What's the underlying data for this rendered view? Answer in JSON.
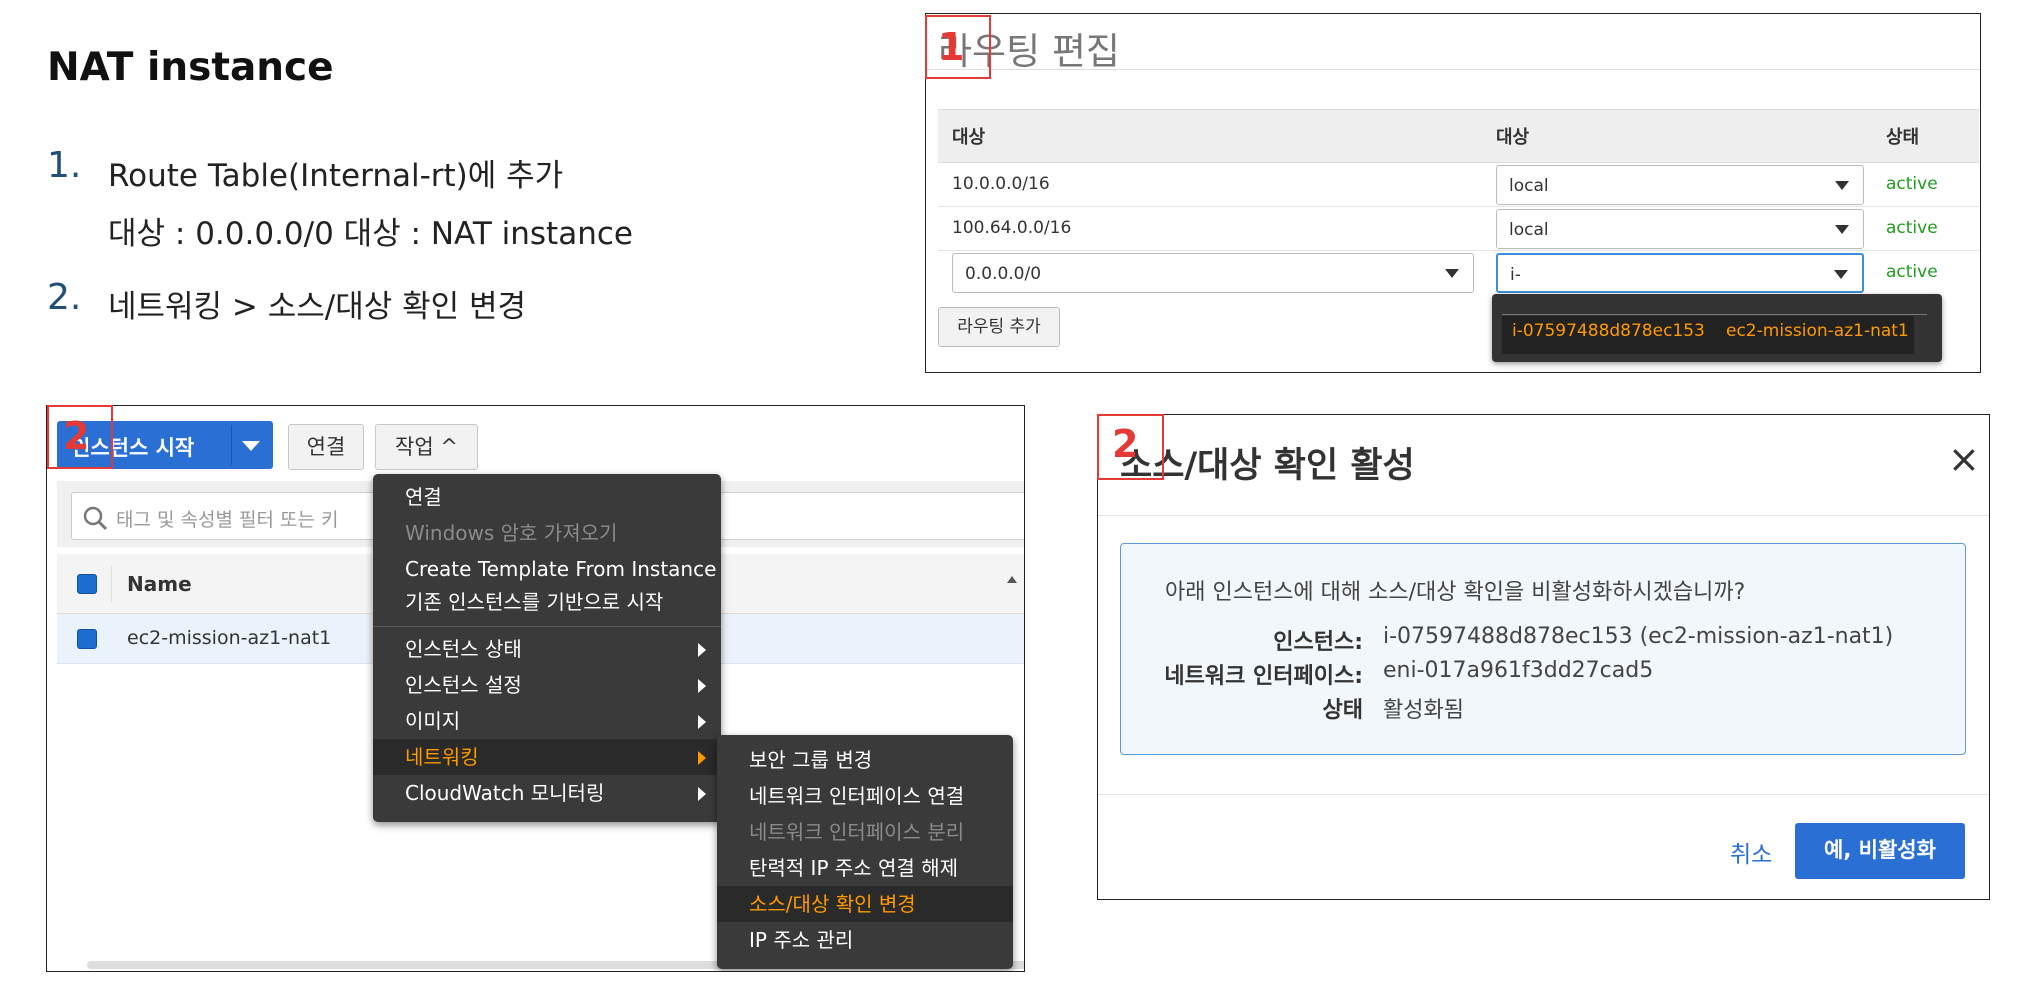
{
  "slide": {
    "title": "NAT instance",
    "steps": [
      {
        "num": "1.",
        "line1": "Route Table(Internal-rt)에 추가",
        "line2": "대상 : 0.0.0.0/0 대상 : NAT instance"
      },
      {
        "num": "2.",
        "line1": "네트워킹 > 소스/대상 확인 변경"
      }
    ]
  },
  "routing_panel": {
    "title": "라우팅 편집",
    "marker": "1",
    "columns": [
      "대상",
      "대상",
      "상태"
    ],
    "rows": [
      {
        "destination": "10.0.0.0/16",
        "target": "local",
        "status": "active"
      },
      {
        "destination": "100.64.0.0/16",
        "target": "local",
        "status": "active"
      },
      {
        "destination": "0.0.0.0/0",
        "target": "i-",
        "status": "active"
      }
    ],
    "add_route_label": "라우팅 추가",
    "dropdown_option": {
      "id": "i-07597488d878ec153",
      "name": "ec2-mission-az1-nat1"
    }
  },
  "instances_panel": {
    "marker": "2",
    "launch_label": "인스턴스 시작",
    "connect_label": "연결",
    "actions_label": "작업 ^",
    "filter_placeholder": "태그 및 속성별 필터 또는 키",
    "column_name": "Name",
    "row_name": "ec2-mission-az1-nat1",
    "actions_menu": [
      {
        "label": "연결",
        "disabled": false
      },
      {
        "label": "Windows 암호 가져오기",
        "disabled": true
      },
      {
        "label": "Create Template From Instance",
        "disabled": false
      },
      {
        "label": "기존 인스턴스를 기반으로 시작",
        "disabled": false
      },
      {
        "label": "인스턴스 상태",
        "submenu": true
      },
      {
        "label": "인스턴스 설정",
        "submenu": true
      },
      {
        "label": "이미지",
        "submenu": true
      },
      {
        "label": "네트워킹",
        "submenu": true,
        "highlighted": true
      },
      {
        "label": "CloudWatch 모니터링",
        "submenu": true
      }
    ],
    "networking_submenu": [
      {
        "label": "보안 그룹 변경",
        "disabled": false
      },
      {
        "label": "네트워크 인터페이스 연결",
        "disabled": false
      },
      {
        "label": "네트워크 인터페이스 분리",
        "disabled": true
      },
      {
        "label": "탄력적 IP 주소 연결 해제",
        "disabled": false
      },
      {
        "label": "소스/대상 확인 변경",
        "highlighted": true
      },
      {
        "label": "IP 주소 관리",
        "disabled": false
      }
    ]
  },
  "dialog": {
    "marker": "2",
    "title": "소스/대상 확인 활성",
    "close": "×",
    "question": "아래 인스턴스에 대해 소스/대상 확인을 비활성화하시겠습니까?",
    "fields": [
      {
        "label": "인스턴스:",
        "value": "i-07597488d878ec153 (ec2-mission-az1-nat1)"
      },
      {
        "label": "네트워크 인터페이스:",
        "value": "eni-017a961f3dd27cad5"
      },
      {
        "label": "상태",
        "value": "활성화됨"
      }
    ],
    "cancel_label": "취소",
    "confirm_label": "예, 비활성화"
  },
  "colors": {
    "accent_blue": "#2a6fd3",
    "marker_red": "#e53935",
    "highlight_orange": "#ff9900",
    "active_green": "#1e9b1e"
  }
}
